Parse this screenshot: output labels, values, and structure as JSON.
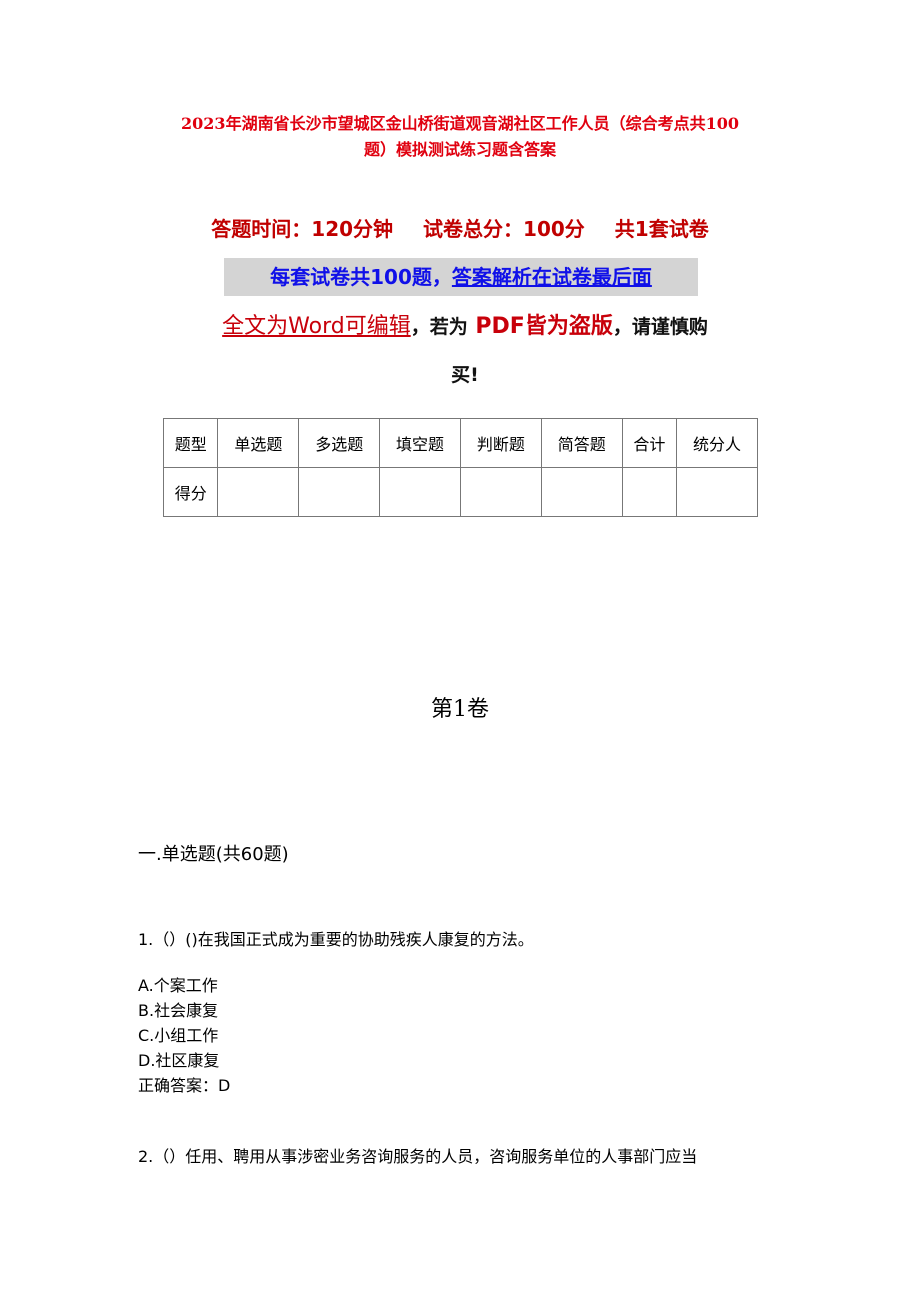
{
  "document": {
    "title_line1": "2023年湖南省长沙市望城区金山桥街道观音湖社区工作人员（综合考点共100",
    "title_line2": "题）模拟测试练习题含答案",
    "meta": {
      "time": "答题时间：120分钟",
      "total": "试卷总分：100分",
      "sets": "共1套试卷"
    },
    "info": {
      "part1": "每套试卷共100题，",
      "part2": "答案解析在试卷最后面"
    },
    "notice": {
      "editable": "全文为Word可编辑",
      "comma1": "，",
      "if_pdf": "若为",
      "pdf_pirate": "PDF皆为盗版",
      "comma2": "，",
      "careful": "请谨慎购",
      "buy": "买!"
    },
    "score_table": {
      "headers": [
        "题型",
        "单选题",
        "多选题",
        "填空题",
        "判断题",
        "简答题",
        "合计",
        "统分人"
      ],
      "row_label": "得分",
      "row_values": [
        "",
        "",
        "",
        "",
        "",
        "",
        ""
      ]
    },
    "volume_title": "第1卷",
    "section_title": "一.单选题(共60题)",
    "questions": [
      {
        "text": "1.（）()在我国正式成为重要的协助残疾人康复的方法。",
        "options": [
          "A.个案工作",
          "B.社会康复",
          "C.小组工作",
          "D.社区康复"
        ],
        "answer": "正确答案：D"
      },
      {
        "text": "2.（）任用、聘用从事涉密业务咨询服务的人员，咨询服务单位的人事部门应当"
      }
    ]
  }
}
